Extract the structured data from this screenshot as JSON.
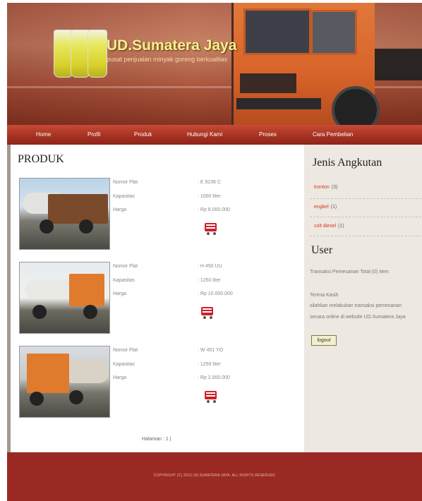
{
  "site": {
    "title": "UD.Sumatera Jaya",
    "subtitle": "pusat penjualan minyak goreng berkualitas"
  },
  "nav": {
    "items": [
      "Home",
      "Profil",
      "Produk",
      "Hubungi Kami",
      "Proses",
      "Cara Pembelian"
    ]
  },
  "main": {
    "heading": "PRODUK",
    "products": [
      {
        "plat_label": "Nomor Plat",
        "plat": ": E 9236 C",
        "kapasitas_label": "Kapasitas",
        "kapasitas": ": 1000 liter",
        "harga_label": "Harga",
        "harga": ": Rp 8.000.000"
      },
      {
        "plat_label": "Nomor Plat",
        "plat": ": H 450 UU",
        "kapasitas_label": "Kapasitas",
        "kapasitas": ": 1250 liter",
        "harga_label": "Harga",
        "harga": ": Rp 10.000.000"
      },
      {
        "plat_label": "Nomor Plat",
        "plat": ": W 451 YO",
        "kapasitas_label": "Kapasitas",
        "kapasitas": ": 1250 liter",
        "harga_label": "Harga",
        "harga": ": Rp 2.000.000"
      }
    ],
    "pager": "Halaman : 1 |"
  },
  "sidebar": {
    "jenis_heading": "Jenis Angkutan",
    "categories": [
      {
        "name": "tronton",
        "count": "(3)"
      },
      {
        "name": "engkel",
        "count": "(1)"
      },
      {
        "name": "colt diesel",
        "count": "(1)"
      }
    ],
    "user_heading": "User",
    "transaksi": "Transaksi Pemesanan Total (0) item",
    "terima_kasih": "Terima Kasih",
    "msg_line1": "silahkan melakukan transaksi pemesanan",
    "msg_line2": "secara online di website UD.Sumatera Jaya",
    "logout": "logout"
  },
  "footer": {
    "copyright": "COPYRIGHT (C) 2013 UD.SUMATERA JAYA. ALL RIGHTS RESERVED"
  },
  "colors": {
    "nav_bg": "#a73222",
    "footer_bg": "#9b2a24",
    "link_red": "#d2391e",
    "sidebar_bg": "#ede8e1"
  }
}
